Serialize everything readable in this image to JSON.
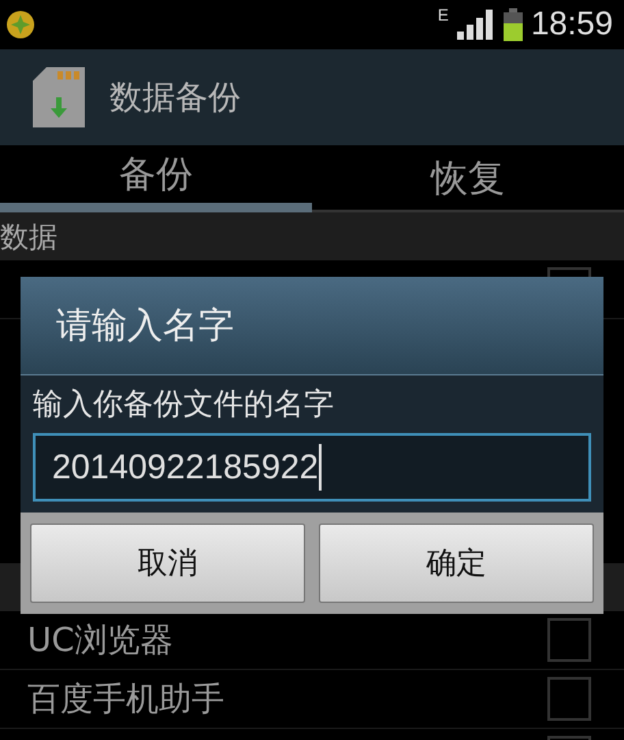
{
  "status_bar": {
    "network": "E",
    "time": "18:59"
  },
  "app_bar": {
    "title": "数据备份"
  },
  "tabs": [
    {
      "label": "备份",
      "selected": true
    },
    {
      "label": "恢复",
      "selected": false
    }
  ],
  "list": [
    {
      "kind": "header",
      "label": "数据"
    },
    {
      "kind": "row",
      "checked": false
    },
    {
      "kind": "gap"
    },
    {
      "kind": "header"
    },
    {
      "kind": "row",
      "label": "UC浏览器",
      "checked": false
    },
    {
      "kind": "row",
      "label": "百度手机助手",
      "checked": false
    },
    {
      "kind": "row",
      "checked": false
    }
  ],
  "dialog": {
    "title": "请输入名字",
    "message": "输入你备份文件的名字",
    "input_value": "20140922185922",
    "buttons": [
      "取消",
      "确定"
    ]
  }
}
